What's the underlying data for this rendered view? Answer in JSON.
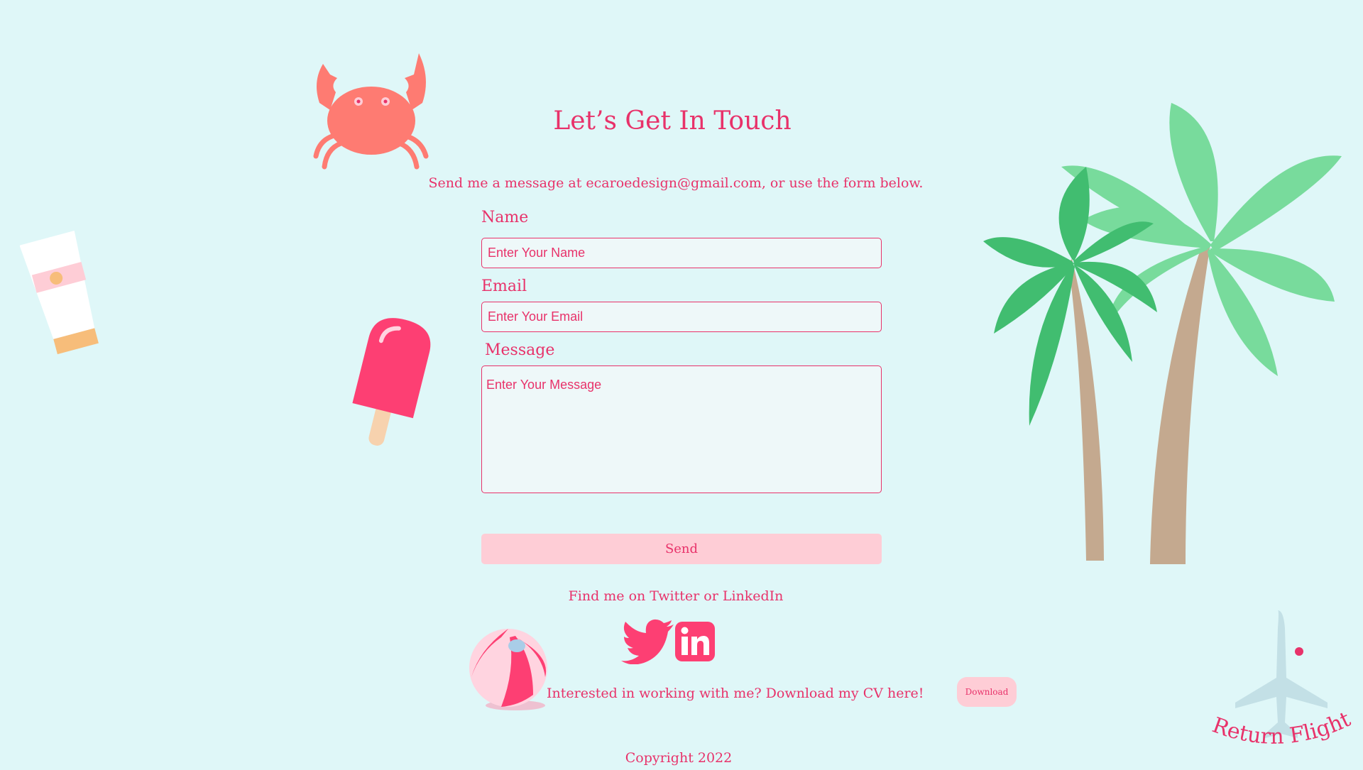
{
  "header": {
    "title": "Let’s Get In Touch",
    "subtitle": "Send me a message at ecaroedesign@gmail.com, or use the form below."
  },
  "form": {
    "name_label": "Name",
    "name_placeholder": "Enter Your Name",
    "email_label": "Email",
    "email_placeholder": "Enter Your Email",
    "message_label": "Message",
    "message_placeholder": "Enter Your Message",
    "send_label": "Send"
  },
  "social": {
    "text": "Find me on Twitter or LinkedIn",
    "twitter_icon": "twitter-icon",
    "linkedin_icon": "linkedin-icon"
  },
  "cv": {
    "text": "Interested in working with me? Download my CV here!",
    "download_label": "Download"
  },
  "footer": {
    "copyright": "Copyright 2022"
  },
  "logo": {
    "text": "Return Flight"
  },
  "colors": {
    "background": "#dff7f8",
    "accent": "#e8326a",
    "button": "#fecdd6",
    "field_bg": "#eef8f9"
  },
  "decorations": [
    "crab-illustration",
    "sunscreen-illustration",
    "popsicle-illustration",
    "palm-trees-illustration",
    "beach-ball-illustration",
    "airplane-logo"
  ]
}
